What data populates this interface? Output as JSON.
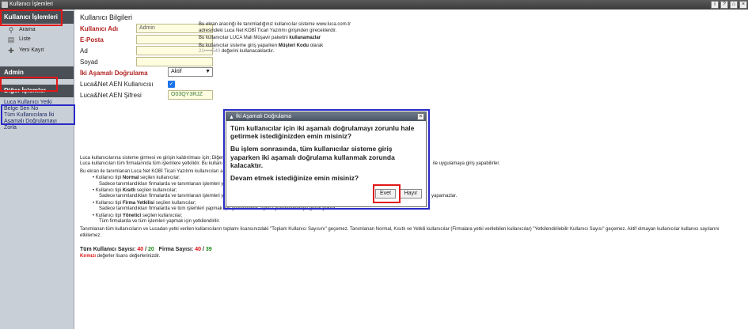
{
  "window": {
    "title": "Kullanıcı İşlemleri",
    "controls": [
      "i",
      "?",
      "⌂",
      "×"
    ]
  },
  "sidebar": {
    "section_users": "Kullanıcı İşlemleri",
    "items": [
      {
        "label": "Arama",
        "icon": "search-icon"
      },
      {
        "label": "Liste",
        "icon": "list-icon"
      },
      {
        "label": "Yeni Kayıt",
        "icon": "add-icon"
      }
    ],
    "section_admin": "Admin",
    "section_other": "Diğer İşlemler",
    "links": [
      "Luca Kullanıcı Yetki",
      "Belge Seri No",
      "Tüm Kullanıcılara İki Aşamalı Doğrulamayı Zorla"
    ]
  },
  "form": {
    "title": "Kullanıcı Bilgileri",
    "username_label": "Kullanıcı Adı",
    "username_value": "Admin",
    "email_label": "E-Posta",
    "email_value": "",
    "first_name_label": "Ad",
    "first_name_value": "",
    "last_name_label": "Soyad",
    "last_name_value": "",
    "two_factor_label": "İki Aşamalı Doğrulama",
    "two_factor_value": "Aktif",
    "aen_user_label": "Luca&Net AEN Kullanıcısı",
    "aen_password_label": "Luca&Net AEN Şifresi",
    "aen_password_value": "O03QY3RJZ"
  },
  "info": {
    "p1": "Bu ekran aracılığı ile tanımladığınız kullanıcılar sisteme www.luca.com.tr adresindeki Luca Net KOBİ Ticari Yazılımı girişinden gireceklerdir.",
    "p2_a": "Bu kullanıcılar LUCA Mali Müşavir paketini ",
    "p2_b": "kullanamazlar",
    "p3_a": "Bu kullanıcılar sisteme giriş yaparken ",
    "p3_b": "Müşteri Kodu",
    "p3_c": " olarak",
    "p3_code": "21•••••540",
    "p3_d": " değerini kullanacaklardır."
  },
  "body": {
    "l1": "Luca kullanıcılarına sisteme girmesi ve girişin kaldırılması için; Diğer",
    "l2": "Luca kullanıcıları tüm firmalarında tüm işlemlere yetkilidir. Bu kullanı",
    "l2_tail": "ile uygulamaya giriş yapabilirler.",
    "l3": "Bu ekran ile tanımlanan Luca Net KOBİ Ticari Yazılımı kullanıcıları a",
    "normal_a": "Kullanıcı tipi ",
    "normal_b": "Normal",
    "normal_c": " seçilen kullanıcılar;",
    "normal_d": "Sadece tanımlandıkları firmalarda ve tanımlanan işlemleri y",
    "kisitli_a": "Kullanıcı tipi ",
    "kisitli_b": "Kısıtlı",
    "kisitli_c": " seçilen kullanıcılar;",
    "kisitli_d": "Sadece tanımlandıkları firmalarda ve tanımlanan işlemleri y",
    "kisitli_tail": "yapamazlar.",
    "firma_a": "Kullanıcı tipi ",
    "firma_b": "Firma Yetkilisi",
    "firma_c": " seçilen kullanıcılar;",
    "firma_d": "Sadece tanımlandıkları firmalarda ve tüm işlemleri yapmak için yetkilendirilir. Ayrıca yetkilendirmeye gerek yoktur.",
    "yonetici_a": "Kullanıcı tipi ",
    "yonetici_b": "Yönetici",
    "yonetici_c": " seçilen kullanıcılar;",
    "yonetici_d": "Tüm firmalarda ve tüm işlemleri yapmak için yetkilendirilir.",
    "license_1": "Tanımlanan tüm kullanıcıların ve Lucadan yetki verilen kullanıcıların toplamı lisansınızdaki \"Toplam Kullanıcı Sayısını\" geçemez. Tanımlanan Normal, Kısıtlı ve Yetkili kullanıcılar (Firmalara yetki verilebilen kullanıcılar) \"Yetkilendirilebilir Kullanıcı Sayısı\" geçemez. Aktif olmayan kullanıcılar kullanıcı sayılarını",
    "license_2": "etkilemez."
  },
  "counts": {
    "total_label": "Tüm Kullanıcı Sayısı:",
    "total_used": "40",
    "sep": "/",
    "total_limit": "20",
    "company_label": "Firma Sayısı:",
    "company_used": "40",
    "company_limit": "39"
  },
  "note": {
    "red": "Kırmızı",
    "rest": " değerler lisans değerlerinizdir."
  },
  "dialog": {
    "title": "İki Aşamalı Doğrulama",
    "line1": "Tüm kullanıcılar için iki aşamalı doğrulamayı zorunlu hale getirmek istediğinizden emin misiniz?",
    "line2": "Bu işlem sonrasında, tüm kullanıcılar sisteme giriş yaparken iki aşamalı doğrulama kullanmak zorunda kalacaktır.",
    "line3": "Devam etmek istediğinize emin misiniz?",
    "yes": "Evet",
    "no": "Hayır"
  },
  "colors": {
    "highlight_red": "#e01818",
    "highlight_blue": "#2a2ac8",
    "required_label": "#b22222",
    "sidebar_bg": "#c9cfd6",
    "header_bg": "#4a4f55"
  }
}
